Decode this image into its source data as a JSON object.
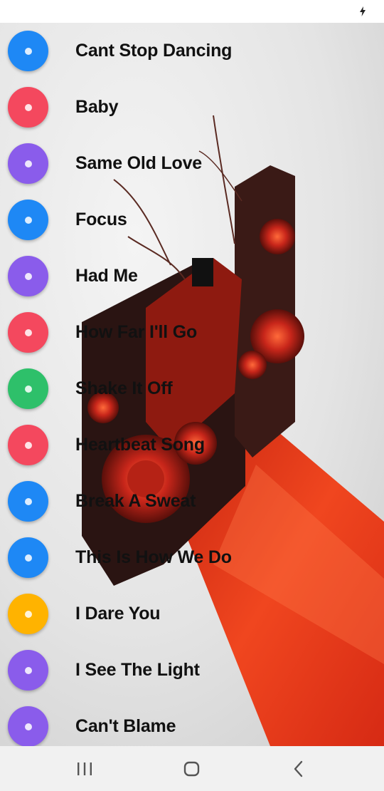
{
  "status_bar": {
    "icons": [
      "charging-bolt-icon"
    ]
  },
  "songs": [
    {
      "title": "Cant Stop Dancing",
      "color": "#1E88F5"
    },
    {
      "title": "Baby",
      "color": "#F4485E"
    },
    {
      "title": "Same Old Love",
      "color": "#8A5CEB"
    },
    {
      "title": "Focus",
      "color": "#1E88F5"
    },
    {
      "title": "Had Me",
      "color": "#8A5CEB"
    },
    {
      "title": "How Far I'll Go",
      "color": "#F4485E"
    },
    {
      "title": "Shake It Off",
      "color": "#2EC06A"
    },
    {
      "title": "Heartbeat Song",
      "color": "#F4485E"
    },
    {
      "title": "Break A Sweat",
      "color": "#1E88F5"
    },
    {
      "title": "This Is How We Do",
      "color": "#1E88F5"
    },
    {
      "title": "I Dare You",
      "color": "#FFB300"
    },
    {
      "title": "I See The Light",
      "color": "#8A5CEB"
    },
    {
      "title": "Can't Blame",
      "color": "#8A5CEB"
    }
  ],
  "nav_bar": {
    "icons": [
      "recent-apps-icon",
      "home-icon",
      "back-icon"
    ]
  }
}
